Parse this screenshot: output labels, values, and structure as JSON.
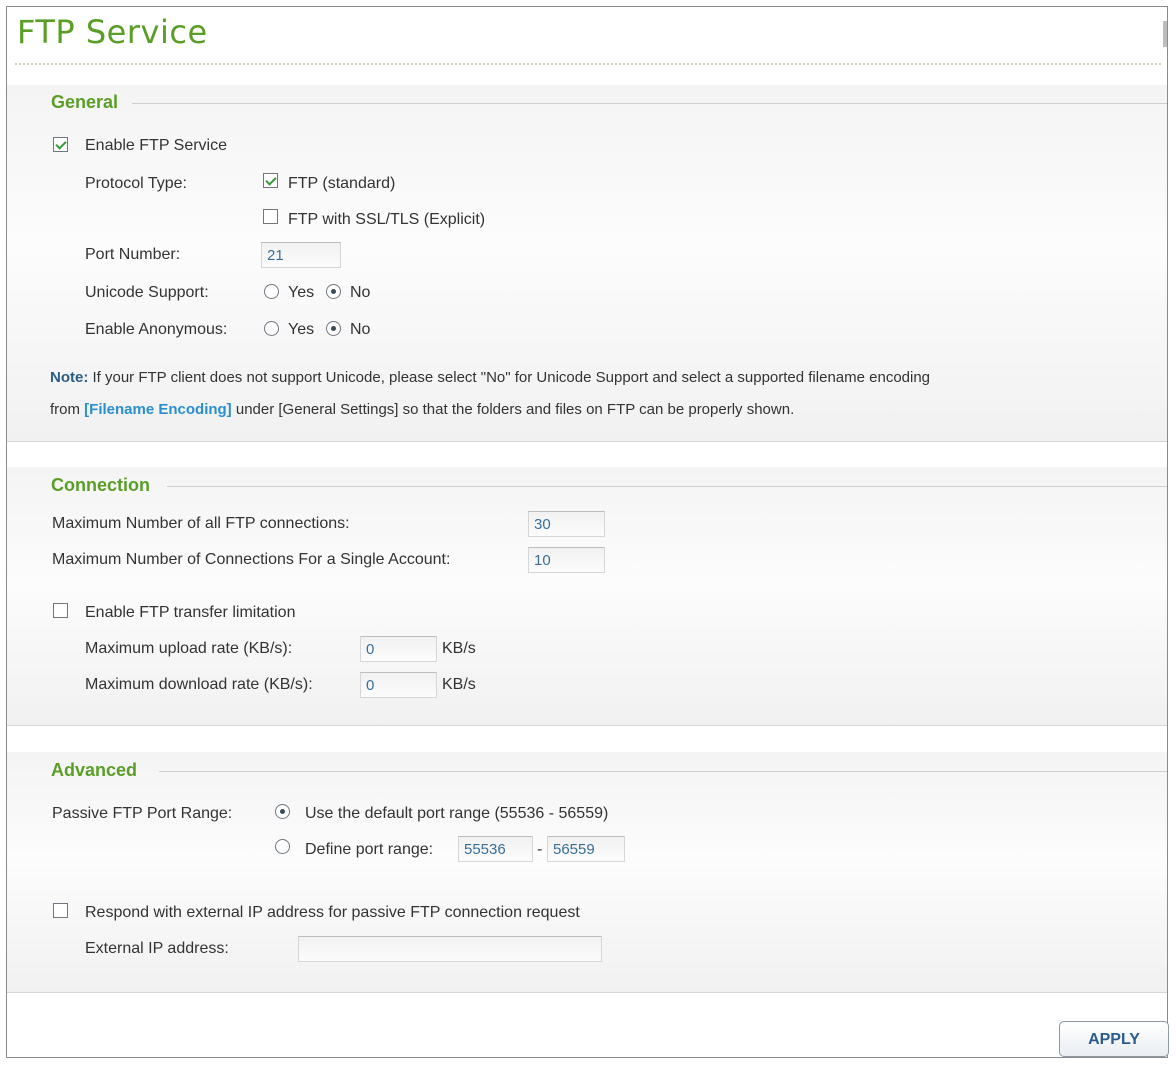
{
  "title": "FTP Service",
  "general": {
    "legend": "General",
    "enable_ftp_label": "Enable FTP Service",
    "protocol_label": "Protocol Type:",
    "ftp_standard_label": "FTP (standard)",
    "ftp_ssl_label": "FTP with SSL/TLS (Explicit)",
    "port_label": "Port Number:",
    "port_value": "21",
    "unicode_label": "Unicode Support:",
    "anonymous_label": "Enable Anonymous:",
    "yes": "Yes",
    "no": "No",
    "note_prefix": "Note:",
    "note_text1": " If your FTP client does not support Unicode, please select \"No\" for Unicode Support and select a supported filename encoding",
    "note_text2_pre": "from ",
    "note_link": "[Filename Encoding]",
    "note_text2_post": " under [General Settings] so that the folders and files on FTP can be properly shown.",
    "state": {
      "enable_ftp": true,
      "ftp_standard": true,
      "ftp_ssl": false,
      "unicode": "No",
      "anonymous": "No"
    }
  },
  "connection": {
    "legend": "Connection",
    "max_all_label": "Maximum Number of all FTP connections:",
    "max_all_value": "30",
    "max_single_label": "Maximum Number of Connections For a Single Account:",
    "max_single_value": "10",
    "transfer_limit_label": "Enable FTP transfer limitation",
    "upload_label": "Maximum upload rate (KB/s):",
    "upload_value": "0",
    "download_label": "Maximum download rate (KB/s):",
    "download_value": "0",
    "unit": "KB/s",
    "state": {
      "transfer_limit": false
    }
  },
  "advanced": {
    "legend": "Advanced",
    "passive_label": "Passive FTP Port Range:",
    "default_range_label": "Use the default port range (55536 - 56559)",
    "define_range_label": "Define port range:",
    "range_start": "55536",
    "range_sep": "-",
    "range_end": "56559",
    "external_ip_check_label": "Respond with external IP address for passive FTP connection request",
    "external_ip_label": "External IP address:",
    "external_ip_value": "",
    "state": {
      "port_range": "default",
      "respond_external": false
    }
  },
  "apply_label": "APPLY"
}
